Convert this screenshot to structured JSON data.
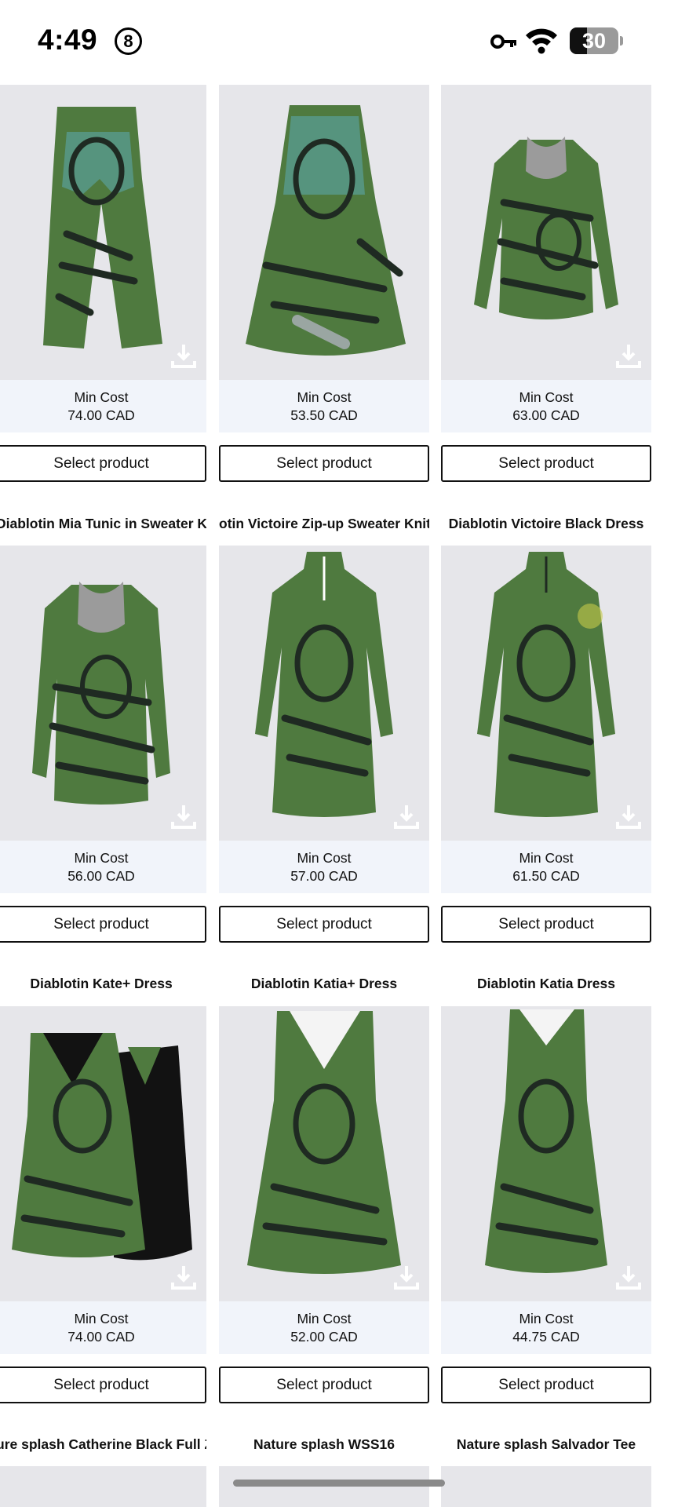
{
  "status_bar": {
    "time": "4:49",
    "badge_number": "8",
    "battery_level": "30",
    "icons": [
      "key-icon",
      "wifi-icon",
      "battery-icon"
    ]
  },
  "colors": {
    "image_bg": "#e6e6ea",
    "cost_bg": "#f1f4fa",
    "garment_green": "#4f7a3f",
    "garment_teal": "#5aa09a",
    "garment_dark": "#1f2a22",
    "black_dress": "#121212"
  },
  "products": {
    "row1": [
      {
        "title": "",
        "min_cost_label": "Min Cost",
        "price": "74.00 CAD",
        "button": "Select product",
        "garment": "pants"
      },
      {
        "title": "",
        "min_cost_label": "Min Cost",
        "price": "53.50 CAD",
        "button": "Select product",
        "garment": "skirt"
      },
      {
        "title": "",
        "min_cost_label": "Min Cost",
        "price": "63.00 CAD",
        "button": "Select product",
        "garment": "tunic"
      }
    ],
    "row2": [
      {
        "title": "Diablotin Mia Tunic in Sweater Knit",
        "min_cost_label": "Min Cost",
        "price": "56.00 CAD",
        "button": "Select product",
        "garment": "tunic"
      },
      {
        "title": "otin Victoire Zip-up Sweater Knit D",
        "min_cost_label": "Min Cost",
        "price": "57.00 CAD",
        "button": "Select product",
        "garment": "dress-zip"
      },
      {
        "title": "Diablotin Victoire Black Dress",
        "min_cost_label": "Min Cost",
        "price": "61.50 CAD",
        "button": "Select product",
        "garment": "dress-zip"
      }
    ],
    "row3": [
      {
        "title": "Diablotin Kate+ Dress",
        "min_cost_label": "Min Cost",
        "price": "74.00 CAD",
        "button": "Select product",
        "garment": "kate"
      },
      {
        "title": "Diablotin Katia+ Dress",
        "min_cost_label": "Min Cost",
        "price": "52.00 CAD",
        "button": "Select product",
        "garment": "sleeveless"
      },
      {
        "title": "Diablotin Katia Dress",
        "min_cost_label": "Min Cost",
        "price": "44.75 CAD",
        "button": "Select product",
        "garment": "sleeveless"
      }
    ],
    "row4": [
      {
        "title": "ure splash Catherine Black Full Zip"
      },
      {
        "title": "Nature splash WSS16"
      },
      {
        "title": "Nature splash Salvador Tee"
      }
    ]
  }
}
